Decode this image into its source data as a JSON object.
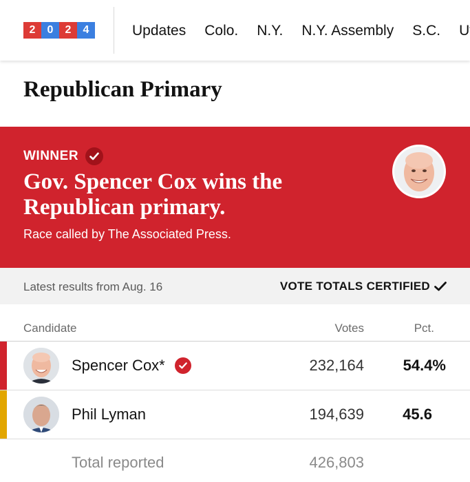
{
  "nav": {
    "logo_digits": [
      "2",
      "0",
      "2",
      "4"
    ],
    "items": [
      "Updates",
      "Colo.",
      "N.Y.",
      "N.Y. Assembly",
      "S.C.",
      "Ut"
    ]
  },
  "race": {
    "title": "Republican Primary"
  },
  "banner": {
    "winner_label": "WINNER",
    "headline": "Gov. Spencer Cox wins the Republican primary.",
    "subtext": "Race called by The Associated Press."
  },
  "status": {
    "latest": "Latest results from Aug. 16",
    "certified": "VOTE TOTALS CERTIFIED"
  },
  "table": {
    "headers": {
      "candidate": "Candidate",
      "votes": "Votes",
      "pct": "Pct."
    },
    "rows": [
      {
        "name": "Spencer Cox*",
        "votes": "232,164",
        "pct": "54.4%",
        "winner": true,
        "color": "#d0232d"
      },
      {
        "name": "Phil Lyman",
        "votes": "194,639",
        "pct": "45.6",
        "winner": false,
        "color": "#e2a600"
      }
    ],
    "total": {
      "label": "Total reported",
      "votes": "426,803"
    }
  },
  "colors": {
    "accent_red": "#d0232d",
    "dark_red": "#a1121a",
    "logo_blue": "#3b7fe0",
    "logo_red": "#dd3b36"
  }
}
